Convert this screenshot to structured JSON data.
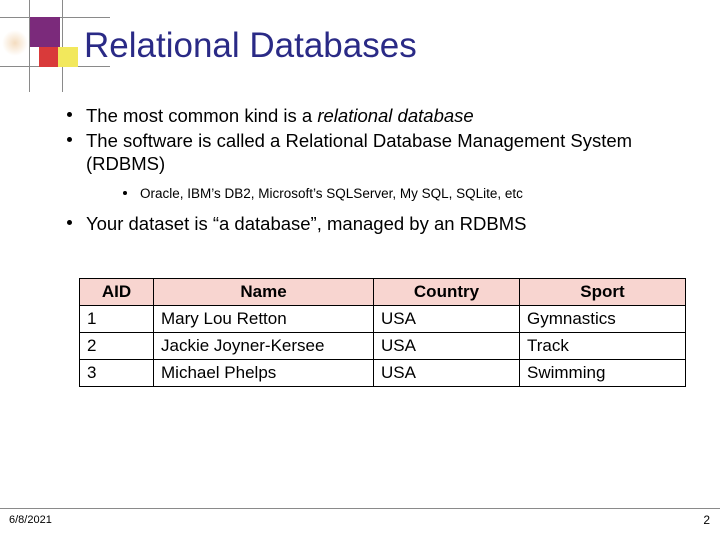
{
  "slide": {
    "title": "Relational Databases",
    "bullets": [
      {
        "level": 1,
        "prefix": "The most common kind is a ",
        "italic": "relational database",
        "suffix": ""
      },
      {
        "level": 1,
        "prefix": "The software is called a Relational Database Management System (RDBMS)",
        "italic": "",
        "suffix": ""
      },
      {
        "level": 2,
        "prefix": "Oracle, IBM’s DB2, Microsoft’s SQLServer, My SQL, SQLite, etc",
        "italic": "",
        "suffix": ""
      },
      {
        "level": 1,
        "prefix": "Your dataset is “a database”, managed by an RDBMS",
        "italic": "",
        "suffix": ""
      }
    ],
    "table": {
      "headers": [
        "AID",
        "Name",
        "Country",
        "Sport"
      ],
      "rows": [
        [
          "1",
          "Mary Lou Retton",
          "USA",
          "Gymnastics"
        ],
        [
          "2",
          "Jackie Joyner-Kersee",
          "USA",
          "Track"
        ],
        [
          "3",
          "Michael Phelps",
          "USA",
          "Swimming"
        ]
      ]
    },
    "footer": {
      "date": "6/8/2021",
      "page_number": "2"
    },
    "colors": {
      "title": "#2a2a86",
      "header_fill": "#f8d5d0",
      "deco_purple": "#7b2a7b",
      "deco_red": "#d93a3a",
      "deco_yellow": "#f2e85c"
    }
  }
}
